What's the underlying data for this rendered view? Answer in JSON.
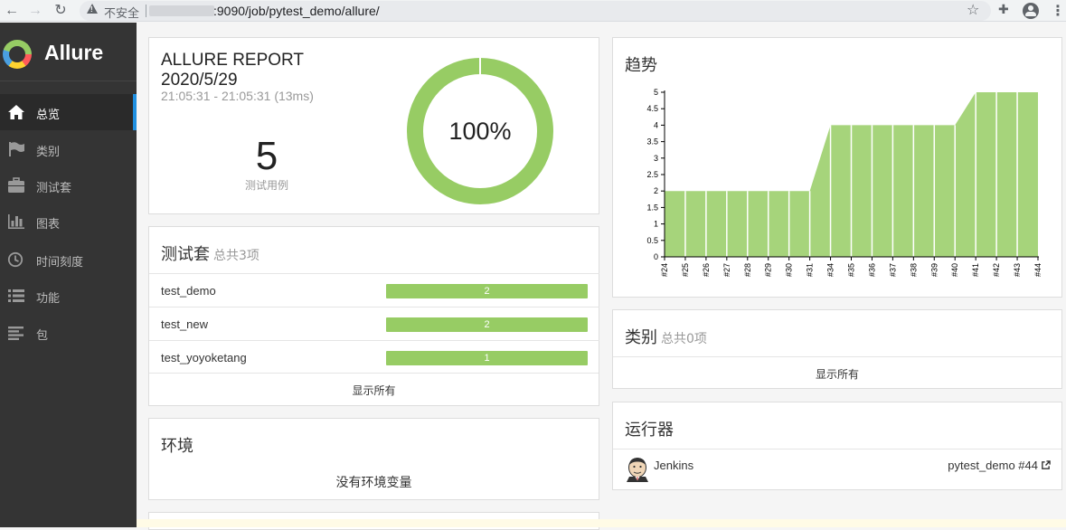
{
  "browser": {
    "insecure_label": "不安全",
    "url": ":9090/job/pytest_demo/allure/"
  },
  "sidebar": {
    "brand": "Allure",
    "items": [
      {
        "label": "总览",
        "icon": "home-icon",
        "active": true
      },
      {
        "label": "类别",
        "icon": "flag-icon",
        "active": false
      },
      {
        "label": "测试套",
        "icon": "briefcase-icon",
        "active": false
      },
      {
        "label": "图表",
        "icon": "bar-chart-icon",
        "active": false
      },
      {
        "label": "时间刻度",
        "icon": "clock-icon",
        "active": false
      },
      {
        "label": "功能",
        "icon": "list-icon",
        "active": false
      },
      {
        "label": "包",
        "icon": "align-left-icon",
        "active": false
      }
    ]
  },
  "report": {
    "title": "ALLURE REPORT",
    "date": "2020/5/29",
    "time_range": "21:05:31 - 21:05:31 (13ms)",
    "test_count": "5",
    "test_count_label": "测试用例",
    "pass_rate": "100%",
    "pass_fraction": 1.0,
    "pass_color": "#97cc64"
  },
  "suites": {
    "title": "测试套",
    "subtitle": "总共3项",
    "items": [
      {
        "name": "test_demo",
        "count": "2"
      },
      {
        "name": "test_new",
        "count": "2"
      },
      {
        "name": "test_yoyoketang",
        "count": "1"
      }
    ],
    "show_all": "显示所有"
  },
  "environment": {
    "title": "环境",
    "empty_text": "没有环境变量"
  },
  "trend": {
    "title": "趋势"
  },
  "chart_data": {
    "type": "area",
    "x": [
      "#24",
      "#25",
      "#26",
      "#27",
      "#28",
      "#29",
      "#30",
      "#31",
      "#34",
      "#35",
      "#36",
      "#37",
      "#38",
      "#39",
      "#40",
      "#41",
      "#42",
      "#43",
      "#44"
    ],
    "values": [
      2,
      2,
      2,
      2,
      2,
      2,
      2,
      2,
      4,
      4,
      4,
      4,
      4,
      4,
      4,
      5,
      5,
      5,
      5
    ],
    "y_ticks": [
      "0",
      "0.5",
      "1",
      "1.5",
      "2",
      "2.5",
      "3",
      "3.5",
      "4",
      "4.5",
      "5"
    ],
    "ylim": [
      0,
      5
    ],
    "color": "#97cc64"
  },
  "categories": {
    "title": "类别",
    "subtitle": "总共0项",
    "show_all": "显示所有"
  },
  "executors": {
    "title": "运行器",
    "name": "Jenkins",
    "build": "pytest_demo #44"
  }
}
